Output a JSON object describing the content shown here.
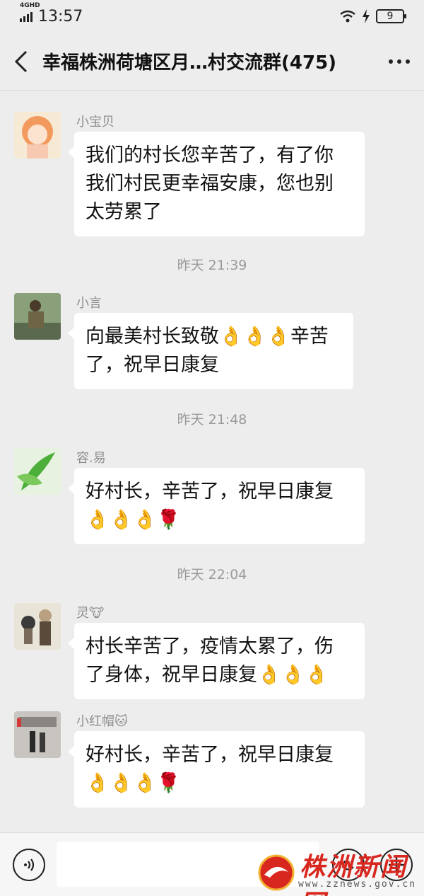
{
  "status_bar": {
    "network": "4GHD",
    "time": "13:57",
    "battery": "9"
  },
  "header": {
    "title": "幸福株洲荷塘区月…村交流群(475)"
  },
  "messages": [
    {
      "sender": "小宝贝",
      "text_lines": [
        "我们的村长您辛苦了，有了你",
        "我们村民更幸福安康，您也别",
        "太劳累了"
      ]
    },
    {
      "time": "昨天 21:39"
    },
    {
      "sender": "小言",
      "text_lines": [
        "向最美村长致敬👌👌👌辛苦",
        "了，祝早日康复"
      ]
    },
    {
      "time": "昨天 21:48"
    },
    {
      "sender": "容.易",
      "text_lines": [
        "好村长，辛苦了，祝早日康复",
        "👌👌👌🌹"
      ]
    },
    {
      "time": "昨天 22:04"
    },
    {
      "sender": "灵🐮",
      "text_lines": [
        "村长辛苦了，疫情太累了，伤",
        "了身体，祝早日康复👌👌👌"
      ]
    },
    {
      "sender": "小红帽🐱",
      "text_lines": [
        "好村长，辛苦了，祝早日康复",
        "👌👌👌🌹"
      ]
    }
  ],
  "icons": [
    "back-arrow-icon",
    "more-icon",
    "voice-icon",
    "emoji-icon",
    "plus-icon",
    "wifi-icon",
    "signal-icon",
    "battery-icon"
  ],
  "watermark": {
    "name": "株洲新闻网",
    "url": "www.zznews.gov.cn"
  },
  "colors": {
    "background": "#ededed",
    "bubble": "#ffffff",
    "watermark_red": "#d8271e"
  }
}
